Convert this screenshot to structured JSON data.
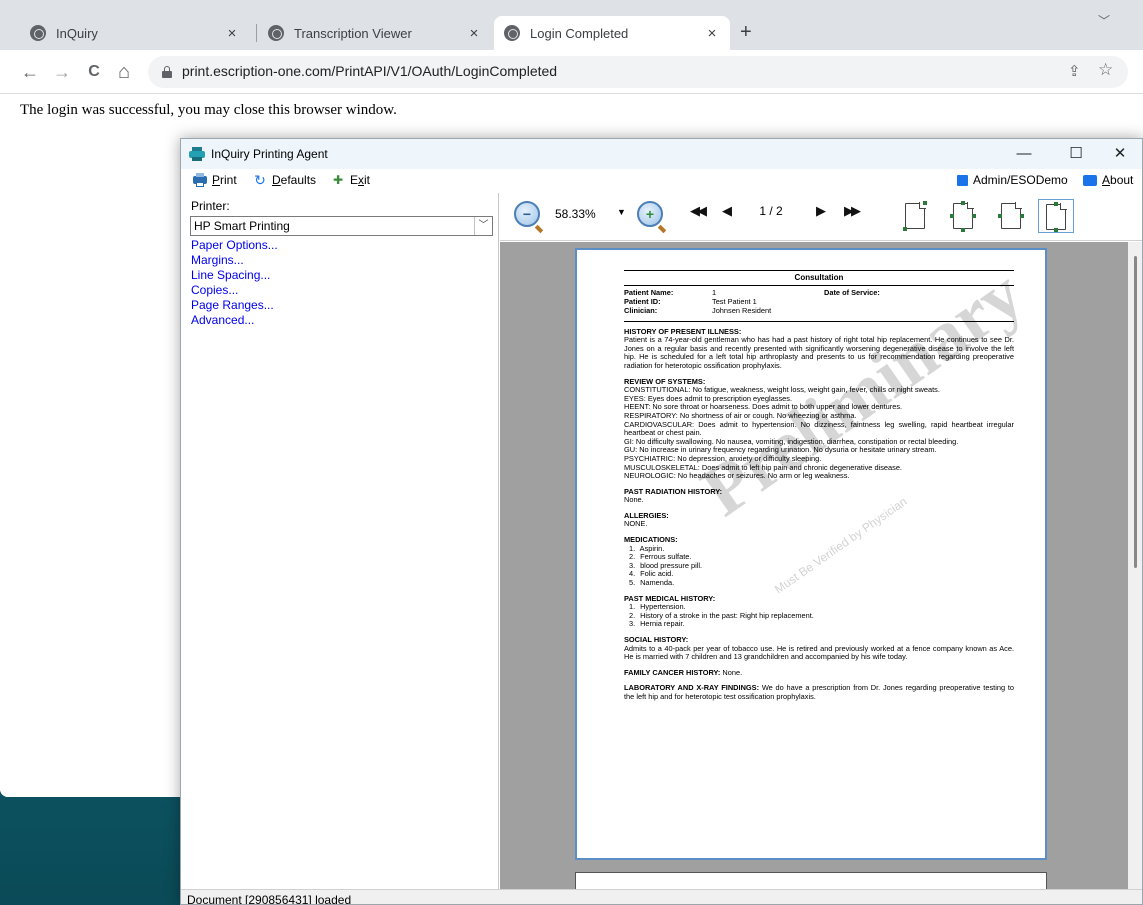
{
  "browser": {
    "tabs": [
      {
        "title": "InQuiry",
        "close": "×"
      },
      {
        "title": "Transcription Viewer",
        "close": "×"
      },
      {
        "title": "Login Completed",
        "close": "×",
        "active": true
      }
    ],
    "new_tab": "+",
    "tabs_dropdown": "﹀",
    "nav": {
      "back": "←",
      "forward": "→",
      "reload": "C",
      "home": "⌂"
    },
    "url": "print.escription-one.com/PrintAPI/V1/OAuth/LoginCompleted",
    "share": "⇪",
    "star": "☆",
    "page_message": "The login was successful, you may close this browser window."
  },
  "app": {
    "title": "InQuiry Printing Agent",
    "controls": {
      "minimize": "—",
      "maximize": "☐",
      "close": "✕"
    },
    "menu": {
      "print": {
        "accel": "P",
        "rest": "rint"
      },
      "defaults": {
        "accel": "D",
        "rest": "efaults"
      },
      "exit": {
        "pre": "E",
        "accel": "x",
        "rest": "it"
      },
      "admin": "Admin/ESODemo",
      "about": {
        "accel": "A",
        "rest": "bout"
      }
    },
    "printer_label": "Printer:",
    "printer_selected": "HP Smart Printing",
    "printer_chevron": "﹀",
    "options": [
      "Paper Options...",
      "Margins...",
      "Line Spacing...",
      "Copies...",
      "Page Ranges...",
      "Advanced..."
    ],
    "viewer": {
      "zoom_level": "58.33%",
      "zoom_dropdown": "▼",
      "zoom_out": "−",
      "zoom_in": "+",
      "first": "◀◀",
      "prev": "◀",
      "next": "▶",
      "last": "▶▶",
      "page": "1 / 2"
    },
    "status": "Document [290856431] loaded"
  },
  "document": {
    "title": "Consultation",
    "patient_name_label": "Patient Name:",
    "patient_name": "1",
    "date_of_service_label": "Date of Service:",
    "patient_id_label": "Patient ID:",
    "patient_id": "Test Patient 1",
    "clinician_label": "Clinician:",
    "clinician": "Johnsen Resident",
    "watermark": "Preliminary",
    "watermark_sub": "Must Be Verified by Physician",
    "hpi_title": "HISTORY OF PRESENT ILLNESS:",
    "hpi_text": "Patient is a 74-year-old gentleman who has had a past history of right total hip replacement. He continues to see Dr. Jones on a regular basis and recently presented with significantly worsening degenerative disease to involve the left hip. He is scheduled for a left total hip arthroplasty and presents to us for recommendation regarding preoperative radiation for heterotopic ossification prophylaxis.",
    "ros_title": "REVIEW OF SYSTEMS:",
    "ros": [
      "CONSTITUTIONAL:  No fatigue, weakness, weight loss, weight gain, fever, chills or night sweats.",
      "EYES:  Eyes does admit to prescription eyeglasses.",
      "HEENT:  No sore throat or hoarseness. Does admit to both upper and lower dentures.",
      "RESPIRATORY:  No shortness of air or cough. No wheezing or asthma.",
      "CARDIOVASCULAR: Does admit to hypertension. No dizziness, faintness leg swelling, rapid heartbeat irregular heartbeat or chest pain.",
      "GI: No difficulty swallowing. No nausea, vomiting, indigestion, diarrhea, constipation or rectal bleeding.",
      "GU:  No increase in urinary frequency regarding urination. No dysuria or hesitate urinary stream.",
      "PSYCHIATRIC:  No depression, anxiety or difficulty sleeping.",
      "MUSCULOSKELETAL:  Does admit to left hip pain and chronic degenerative disease.",
      "NEUROLOGIC:  No headaches or seizures. No arm or leg weakness."
    ],
    "prh_title": "PAST RADIATION HISTORY:",
    "prh_text": "None.",
    "allergies_title": "ALLERGIES:",
    "allergies_text": "NONE.",
    "meds_title": "MEDICATIONS:",
    "meds": [
      "Aspirin.",
      "Ferrous sulfate.",
      "blood pressure pill.",
      "Folic acid.",
      "Namenda."
    ],
    "pmh_title": "PAST MEDICAL HISTORY:",
    "pmh": [
      "Hypertension.",
      "History of a stroke in the past: Right hip replacement.",
      "Hernia repair."
    ],
    "social_title": "SOCIAL HISTORY:",
    "social_text": "Admits to a 40-pack per year of tobacco use. He is retired and previously worked at a fence company known as Ace. He is married with 7 children and 13 grandchildren and accompanied by his wife today.",
    "fch_title": "FAMILY CANCER HISTORY:",
    "fch_text": " None.",
    "lab_title": "LABORATORY AND X-RAY FINDINGS:",
    "lab_text": " We do have a prescription from Dr. Jones regarding preoperative testing to the left hip and for heterotopic test ossification prophylaxis."
  },
  "colors": {
    "accent": "#1a73e8",
    "link": "#0000ee",
    "page_border": "#5a8ec4",
    "doc_background": "#a0a0a0"
  }
}
